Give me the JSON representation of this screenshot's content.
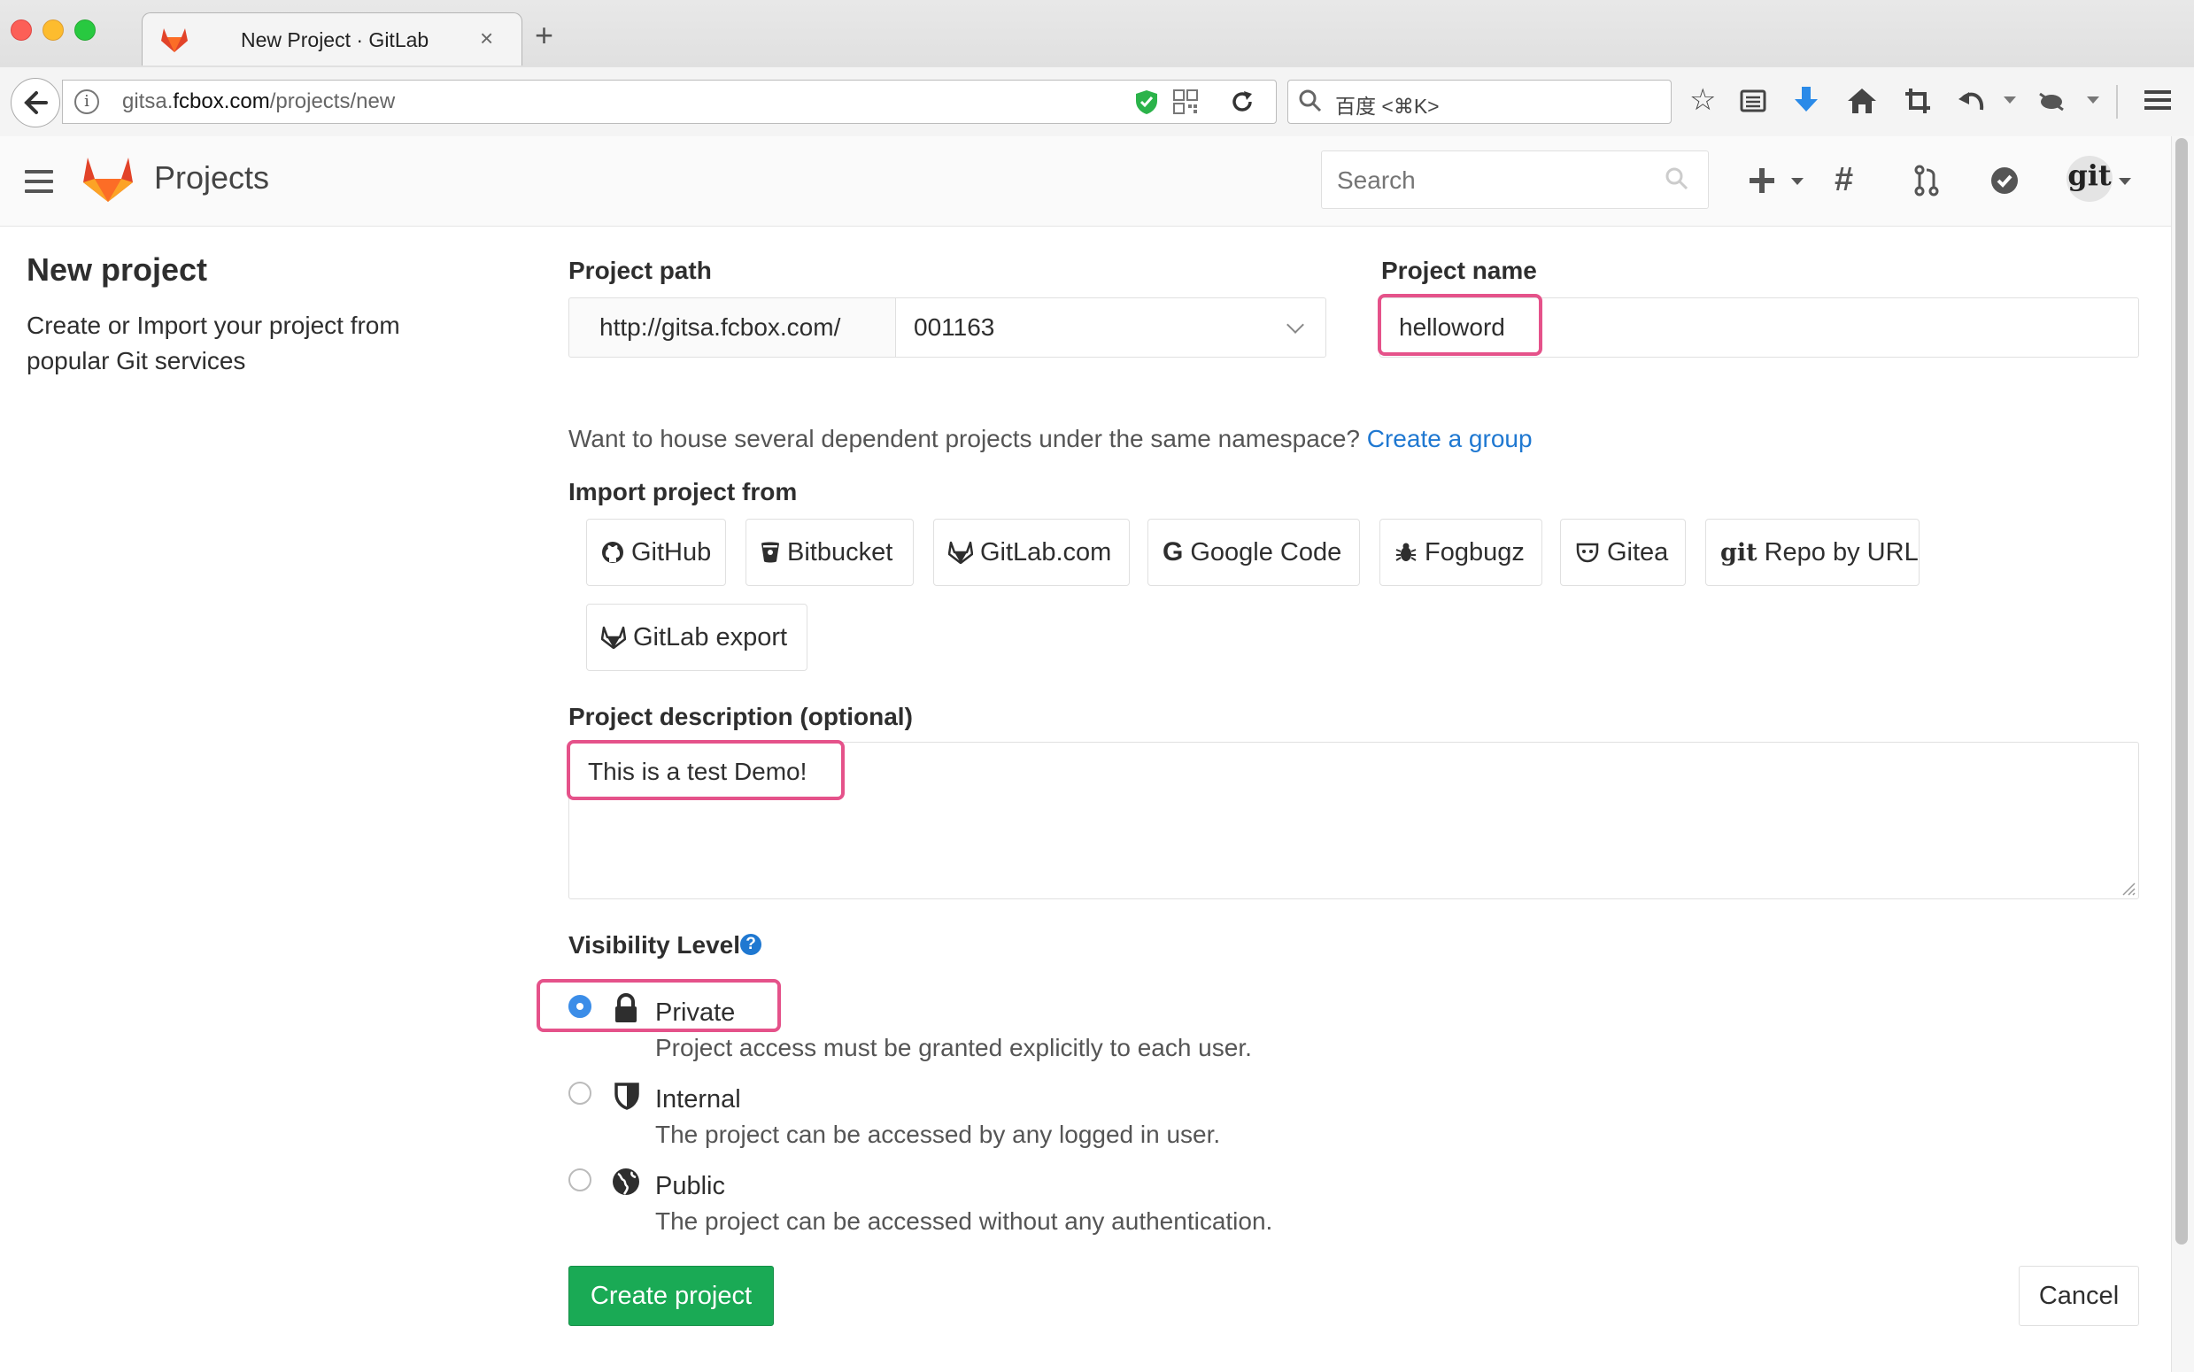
{
  "browser": {
    "tab_title": "New Project · GitLab",
    "tab_close": "×",
    "new_tab": "+",
    "url_prefix": "gitsa.",
    "url_domain": "fcbox.com",
    "url_path": "/projects/new",
    "search_placeholder": "百度 <⌘K>"
  },
  "header": {
    "title": "Projects",
    "search_placeholder": "Search",
    "avatar_text": "git"
  },
  "page": {
    "title": "New project",
    "description": "Create or Import your project from popular Git services"
  },
  "form": {
    "path_label": "Project path",
    "path_prefix": "http://gitsa.fcbox.com/",
    "namespace": "001163",
    "name_label": "Project name",
    "name_value": "helloword",
    "namespace_hint": "Want to house several dependent projects under the same namespace?",
    "namespace_hint_link": "Create a group",
    "import_label": "Import project from",
    "import_sources": [
      {
        "label": "GitHub",
        "icon": "github-icon"
      },
      {
        "label": "Bitbucket",
        "icon": "bitbucket-icon"
      },
      {
        "label": "GitLab.com",
        "icon": "gitlab-icon"
      },
      {
        "label": "Google Code",
        "icon": "google-icon"
      },
      {
        "label": "Fogbugz",
        "icon": "bug-icon"
      },
      {
        "label": "Gitea",
        "icon": "gitea-icon"
      },
      {
        "label": "Repo by URL",
        "icon": "git-icon"
      },
      {
        "label": "GitLab export",
        "icon": "gitlab-icon"
      }
    ],
    "description_label": "Project description (optional)",
    "description_value": "This is a test Demo!",
    "visibility_label": "Visibility Level",
    "visibility_help": "?",
    "visibility_options": [
      {
        "title": "Private",
        "desc": "Project access must be granted explicitly to each user.",
        "checked": true,
        "icon": "lock-icon"
      },
      {
        "title": "Internal",
        "desc": "The project can be accessed by any logged in user.",
        "checked": false,
        "icon": "shield-icon"
      },
      {
        "title": "Public",
        "desc": "The project can be accessed without any authentication.",
        "checked": false,
        "icon": "globe-icon"
      }
    ],
    "create_button": "Create project",
    "cancel_button": "Cancel"
  },
  "colors": {
    "primary_green": "#1aaa55",
    "link_blue": "#1f78d1",
    "highlight_pink": "#e5528a"
  }
}
